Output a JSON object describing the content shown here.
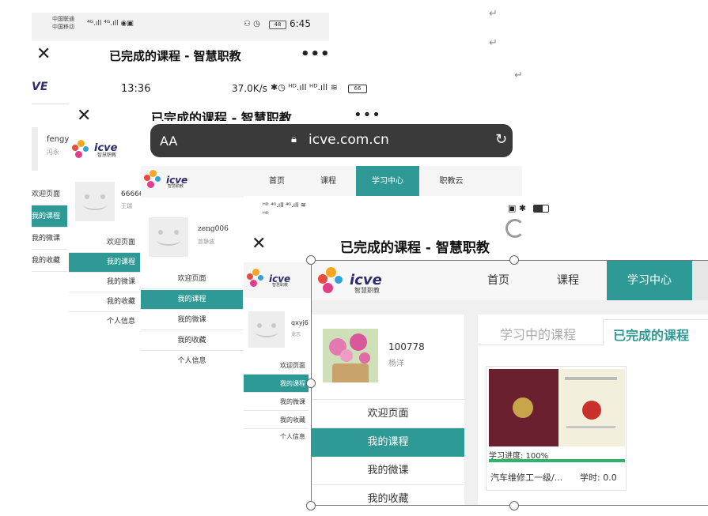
{
  "shot1": {
    "carrier1": "中国联通",
    "carrier2": "中国移动",
    "status_right": "6:45",
    "battery": "48",
    "title": "已完成的课程 - 智慧职教",
    "user_name": "fengy",
    "user_sub": "冯永",
    "menu": [
      "欢迎页面",
      "我的课程",
      "我的微课",
      "我的收藏"
    ]
  },
  "shot2": {
    "time": "13:36",
    "speed": "37.0K/s",
    "battery": "66",
    "title": "已完成的课程 - 智慧职教",
    "user_name": "66666",
    "user_sub": "王瑞",
    "menu": [
      "欢迎页面",
      "我的课程",
      "我的微课",
      "我的收藏",
      "个人信息"
    ]
  },
  "shot3": {
    "aa": "AA",
    "url": "icve.com.cn",
    "nav": [
      "首页",
      "课程",
      "学习中心",
      "职教云"
    ],
    "user_name": "zeng006",
    "user_sub": "曾静波",
    "menu": [
      "欢迎页面",
      "我的课程",
      "我的微课",
      "我的收藏",
      "个人信息"
    ]
  },
  "shot4": {
    "title": "已完成的课程 - 智慧职教",
    "user_name": "qxyj6",
    "user_sub": "龙志",
    "menu": [
      "欢迎页面",
      "我的课程",
      "我的微课",
      "我的收藏",
      "个人信息"
    ]
  },
  "shot5": {
    "nav": [
      "首页",
      "课程",
      "学习中心"
    ],
    "user_id": "100778",
    "user_name": "杨洋",
    "menu": [
      "欢迎页面",
      "我的课程",
      "我的微课",
      "我的收藏"
    ],
    "tab_learning": "学习中的课程",
    "tab_done": "已完成的课程",
    "progress_label": "学习进度: 100%",
    "progress": 1.0,
    "course_name": "汽车维修工一级/...",
    "course_hours": "学时: 0.0"
  },
  "logo": {
    "text": "icve",
    "sub": "智慧职教"
  },
  "colors": {
    "accent": "#2f9a95",
    "dark": "#3a3a3a"
  }
}
